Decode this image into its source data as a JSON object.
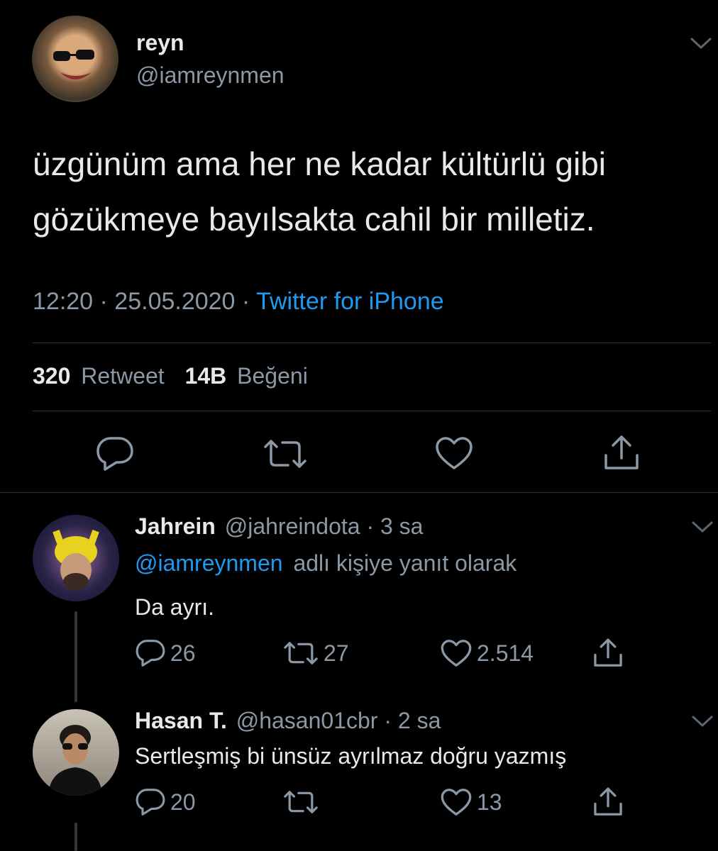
{
  "main_tweet": {
    "display_name": "reyn",
    "handle": "@iamreynmen",
    "text_line1": "üzgünüm ama her ne kadar kültürlü gibi",
    "text_line2": "gözükmeye bayılsakta cahil bir milletiz.",
    "time": "12:20 · 25.05.2020 ·",
    "source": "Twitter for iPhone",
    "retweet_count": "320",
    "retweet_label": "Retweet",
    "like_count": "14B",
    "like_label": "Beğeni"
  },
  "replies": [
    {
      "display_name": "Jahrein",
      "handle": "@jahreindota",
      "time": "· 3 sa",
      "reply_to_handle": "@iamreynmen",
      "reply_to_suffix": "adlı kişiye yanıt olarak",
      "text": "Da ayrı.",
      "reply_count": "26",
      "retweet_count": "27",
      "like_count": "2.514"
    },
    {
      "display_name": "Hasan T.",
      "handle": "@hasan01cbr",
      "time": "· 2 sa",
      "text": "Sertleşmiş bi ünsüz ayrılmaz doğru yazmış",
      "reply_count": "20",
      "retweet_count": "",
      "like_count": "13"
    }
  ],
  "colors": {
    "background": "#000000",
    "text": "#e7e9ea",
    "muted": "#8b98a5",
    "link": "#1d9bf0",
    "divider": "#2f3336"
  },
  "icons": [
    "chevron-down-icon",
    "reply-icon",
    "retweet-icon",
    "like-icon",
    "share-icon"
  ]
}
